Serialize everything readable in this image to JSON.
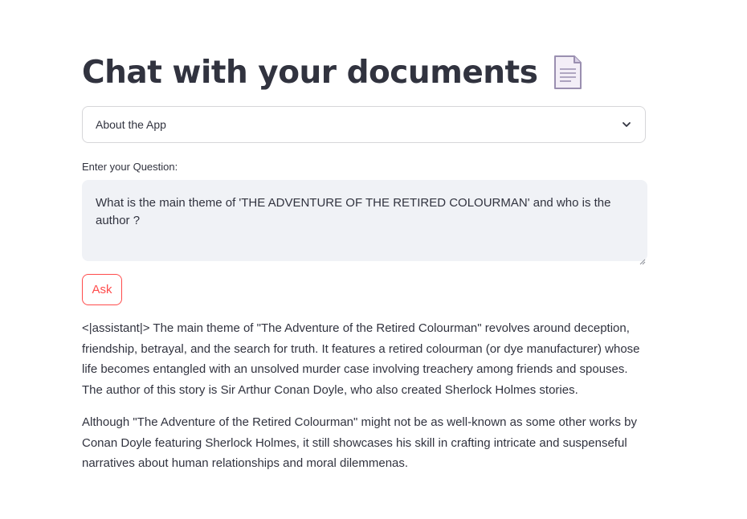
{
  "page": {
    "title": "Chat with your documents",
    "title_icon": "page-document-icon"
  },
  "expander": {
    "label": "About the App",
    "icon": "chevron-down-icon"
  },
  "question": {
    "label": "Enter your Question:",
    "value": "What is the main theme of 'THE ADVENTURE OF THE RETIRED COLOURMAN' and who is the author ?"
  },
  "ask_button": {
    "label": "Ask"
  },
  "answer": {
    "paragraph_1": "<|assistant|> The main theme of \"The Adventure of the Retired Colourman\" revolves around deception, friendship, betrayal, and the search for truth. It features a retired colourman (or dye manufacturer) whose life becomes entangled with an unsolved murder case involving treachery among friends and spouses. The author of this story is Sir Arthur Conan Doyle, who also created Sherlock Holmes stories.",
    "paragraph_2": "Although \"The Adventure of the Retired Colourman\" might not be as well-known as some other works by Conan Doyle featuring Sherlock Holmes, it still showcases his skill in crafting intricate and suspenseful narratives about human relationships and moral dilemmenas."
  },
  "colors": {
    "text": "#31333f",
    "accent": "#ff4b4b",
    "input_bg": "#f0f2f6"
  }
}
